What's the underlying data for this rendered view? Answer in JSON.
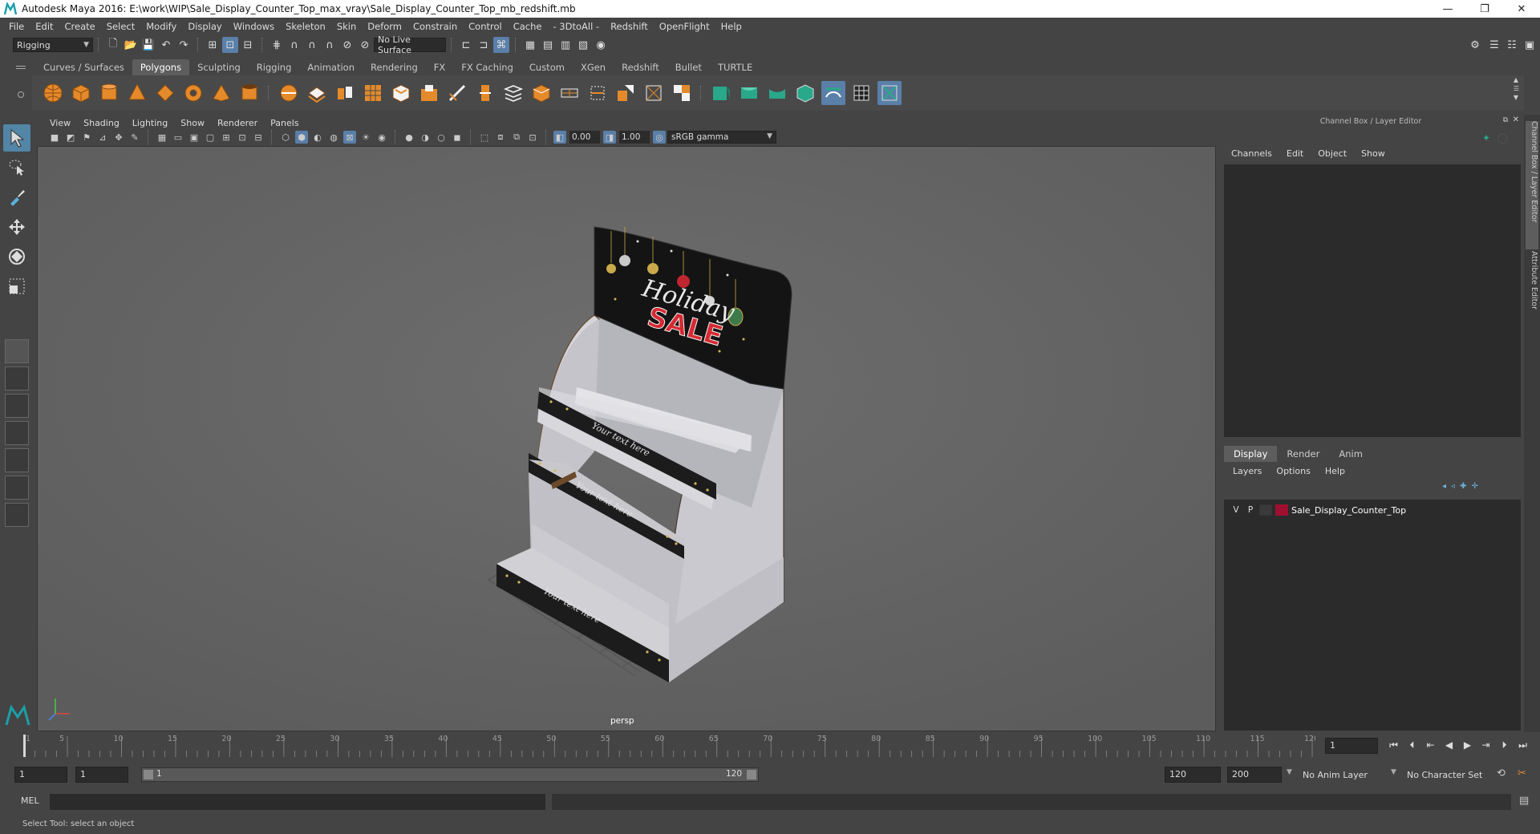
{
  "window": {
    "title": "Autodesk Maya 2016: E:\\work\\WIP\\Sale_Display_Counter_Top_max_vray\\Sale_Display_Counter_Top_mb_redshift.mb",
    "minimize": "—",
    "restore": "❐",
    "close": "✕"
  },
  "menubar": [
    "File",
    "Edit",
    "Create",
    "Select",
    "Modify",
    "Display",
    "Windows",
    "Skeleton",
    "Skin",
    "Deform",
    "Constrain",
    "Control",
    "Cache",
    "- 3DtoAll -",
    "Redshift",
    "OpenFlight",
    "Help"
  ],
  "statusline": {
    "mode": "Rigging",
    "live_surface": "No Live Surface"
  },
  "shelf": {
    "tabs": [
      "Curves / Surfaces",
      "Polygons",
      "Sculpting",
      "Rigging",
      "Animation",
      "Rendering",
      "FX",
      "FX Caching",
      "Custom",
      "XGen",
      "Redshift",
      "Bullet",
      "TURTLE"
    ],
    "active_tab": "Polygons"
  },
  "panel": {
    "menus": [
      "View",
      "Shading",
      "Lighting",
      "Show",
      "Renderer",
      "Panels"
    ],
    "exposure": "0.00",
    "gamma": "1.00",
    "color_space": "sRGB gamma",
    "camera": "persp"
  },
  "model_text": {
    "sign_line1": "Holiday",
    "sign_line2": "SALE",
    "shelf_text": "Your text here"
  },
  "channel_box": {
    "title": "Channel Box / Layer Editor",
    "menus": [
      "Channels",
      "Edit",
      "Object",
      "Show"
    ]
  },
  "layer_editor": {
    "tabs": [
      "Display",
      "Render",
      "Anim"
    ],
    "active_tab": "Display",
    "menus": [
      "Layers",
      "Options",
      "Help"
    ],
    "layers": [
      {
        "visible": "V",
        "playback": "P",
        "name": "Sale_Display_Counter_Top",
        "color": "#9e1030"
      }
    ]
  },
  "side_tabs": [
    "Channel Box / Layer Editor",
    "Attribute Editor"
  ],
  "timeline": {
    "ticks": [
      1,
      5,
      10,
      15,
      20,
      25,
      30,
      35,
      40,
      45,
      50,
      55,
      60,
      65,
      70,
      75,
      80,
      85,
      90,
      95,
      100,
      105,
      110,
      115,
      120
    ],
    "current_frame": "1"
  },
  "range": {
    "start": "1",
    "playback_start": "1",
    "slider_start": "1",
    "slider_end": "120",
    "playback_end": "120",
    "end": "200",
    "anim_layer": "No Anim Layer",
    "character_set": "No Character Set"
  },
  "command": {
    "label": "MEL",
    "help": "Select Tool: select an object"
  }
}
